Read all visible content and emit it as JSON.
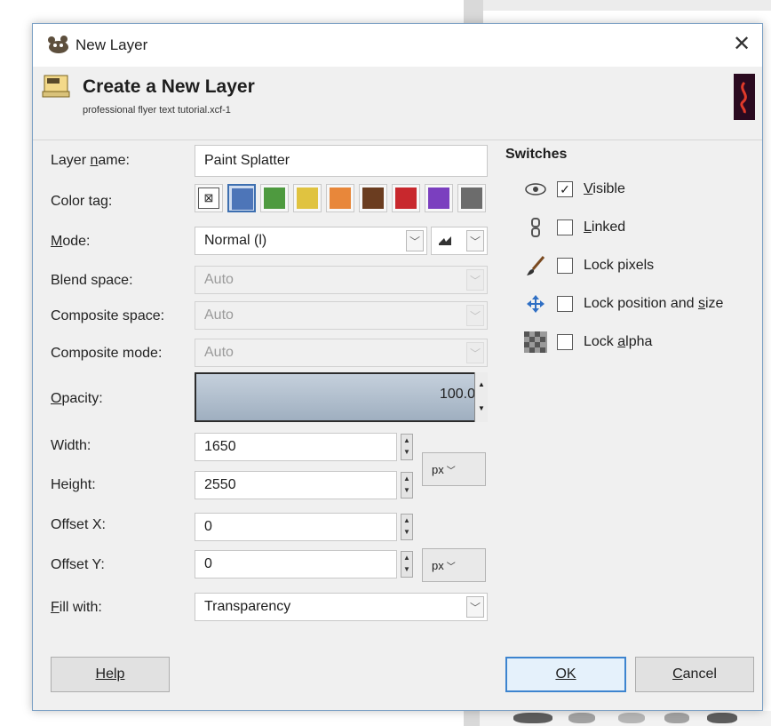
{
  "window": {
    "title": "New Layer",
    "close_glyph": "✕"
  },
  "header": {
    "title": "Create a New Layer",
    "subtitle": "professional flyer text tutorial.xcf-1",
    "icon": "new-layer-icon"
  },
  "form": {
    "layer_name_label": "Layer name:",
    "layer_name_value": "Paint Splatter",
    "color_tag_label": "Color tag:",
    "color_tags": [
      {
        "name": "none",
        "color": "#ffffff"
      },
      {
        "name": "blue",
        "color": "#4d75b8"
      },
      {
        "name": "green",
        "color": "#4e9a3f"
      },
      {
        "name": "yellow",
        "color": "#e0c340"
      },
      {
        "name": "orange",
        "color": "#e8873a"
      },
      {
        "name": "brown",
        "color": "#6b3d20"
      },
      {
        "name": "red",
        "color": "#c8282d"
      },
      {
        "name": "violet",
        "color": "#7b3fbf"
      },
      {
        "name": "gray",
        "color": "#6c6c6c"
      }
    ],
    "selected_color_tag": "blue",
    "mode_label": "Mode:",
    "mode_value": "Normal (l)",
    "blend_space_label": "Blend space:",
    "blend_space_value": "Auto",
    "composite_space_label": "Composite space:",
    "composite_space_value": "Auto",
    "composite_mode_label": "Composite mode:",
    "composite_mode_value": "Auto",
    "opacity_label": "Opacity:",
    "opacity_value": "100.0",
    "opacity_fraction": 1.0,
    "width_label": "Width:",
    "width_value": "1650",
    "height_label": "Height:",
    "height_value": "2550",
    "size_unit": "px",
    "offset_x_label": "Offset X:",
    "offset_x_value": "0",
    "offset_y_label": "Offset Y:",
    "offset_y_value": "0",
    "offset_unit": "px",
    "fill_label": "Fill with:",
    "fill_value": "Transparency"
  },
  "switches": {
    "title": "Switches",
    "items": [
      {
        "label": "Visible",
        "checked": true,
        "icon": "eye-icon"
      },
      {
        "label": "Linked",
        "checked": false,
        "icon": "chain-icon"
      },
      {
        "label": "Lock pixels",
        "checked": false,
        "icon": "paintbrush-icon"
      },
      {
        "label": "Lock position and size",
        "checked": false,
        "icon": "move-arrows-icon"
      },
      {
        "label": "Lock alpha",
        "checked": false,
        "icon": "checkerboard-icon"
      }
    ]
  },
  "buttons": {
    "help": "Help",
    "ok": "OK",
    "cancel": "Cancel"
  },
  "colors": {
    "accent": "#3d84cf",
    "dialog_bg": "#f0f0f0"
  }
}
